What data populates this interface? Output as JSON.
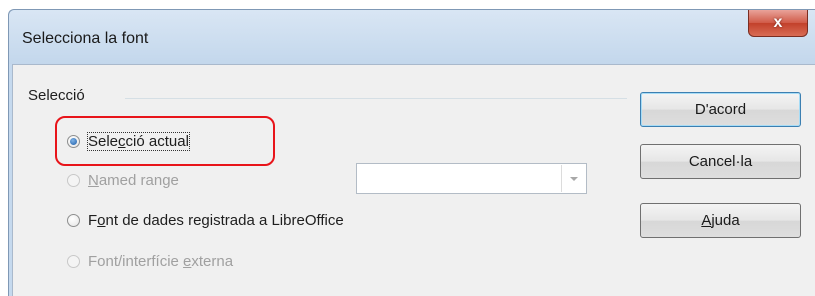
{
  "dialog": {
    "title": "Selecciona la font",
    "close_label": "x"
  },
  "selection_group": {
    "label": "Selecció",
    "options": [
      {
        "pre": "Sele",
        "mnemonic": "c",
        "post": "ció actual",
        "checked": true,
        "enabled": true
      },
      {
        "pre": "",
        "mnemonic": "N",
        "post": "amed range",
        "checked": false,
        "enabled": false
      },
      {
        "pre": "F",
        "mnemonic": "o",
        "post": "nt de dades registrada a LibreOffice",
        "checked": false,
        "enabled": true
      },
      {
        "pre": "Font/interfície ",
        "mnemonic": "e",
        "post": "xterna",
        "checked": false,
        "enabled": false
      }
    ],
    "named_range_value": ""
  },
  "buttons": {
    "ok": "D'acord",
    "cancel": "Cancel·la",
    "help_pre": "",
    "help_mnemonic": "A",
    "help_post": "juda"
  },
  "colors": {
    "highlight": "#e8141a",
    "close_button": "#c2412b"
  }
}
